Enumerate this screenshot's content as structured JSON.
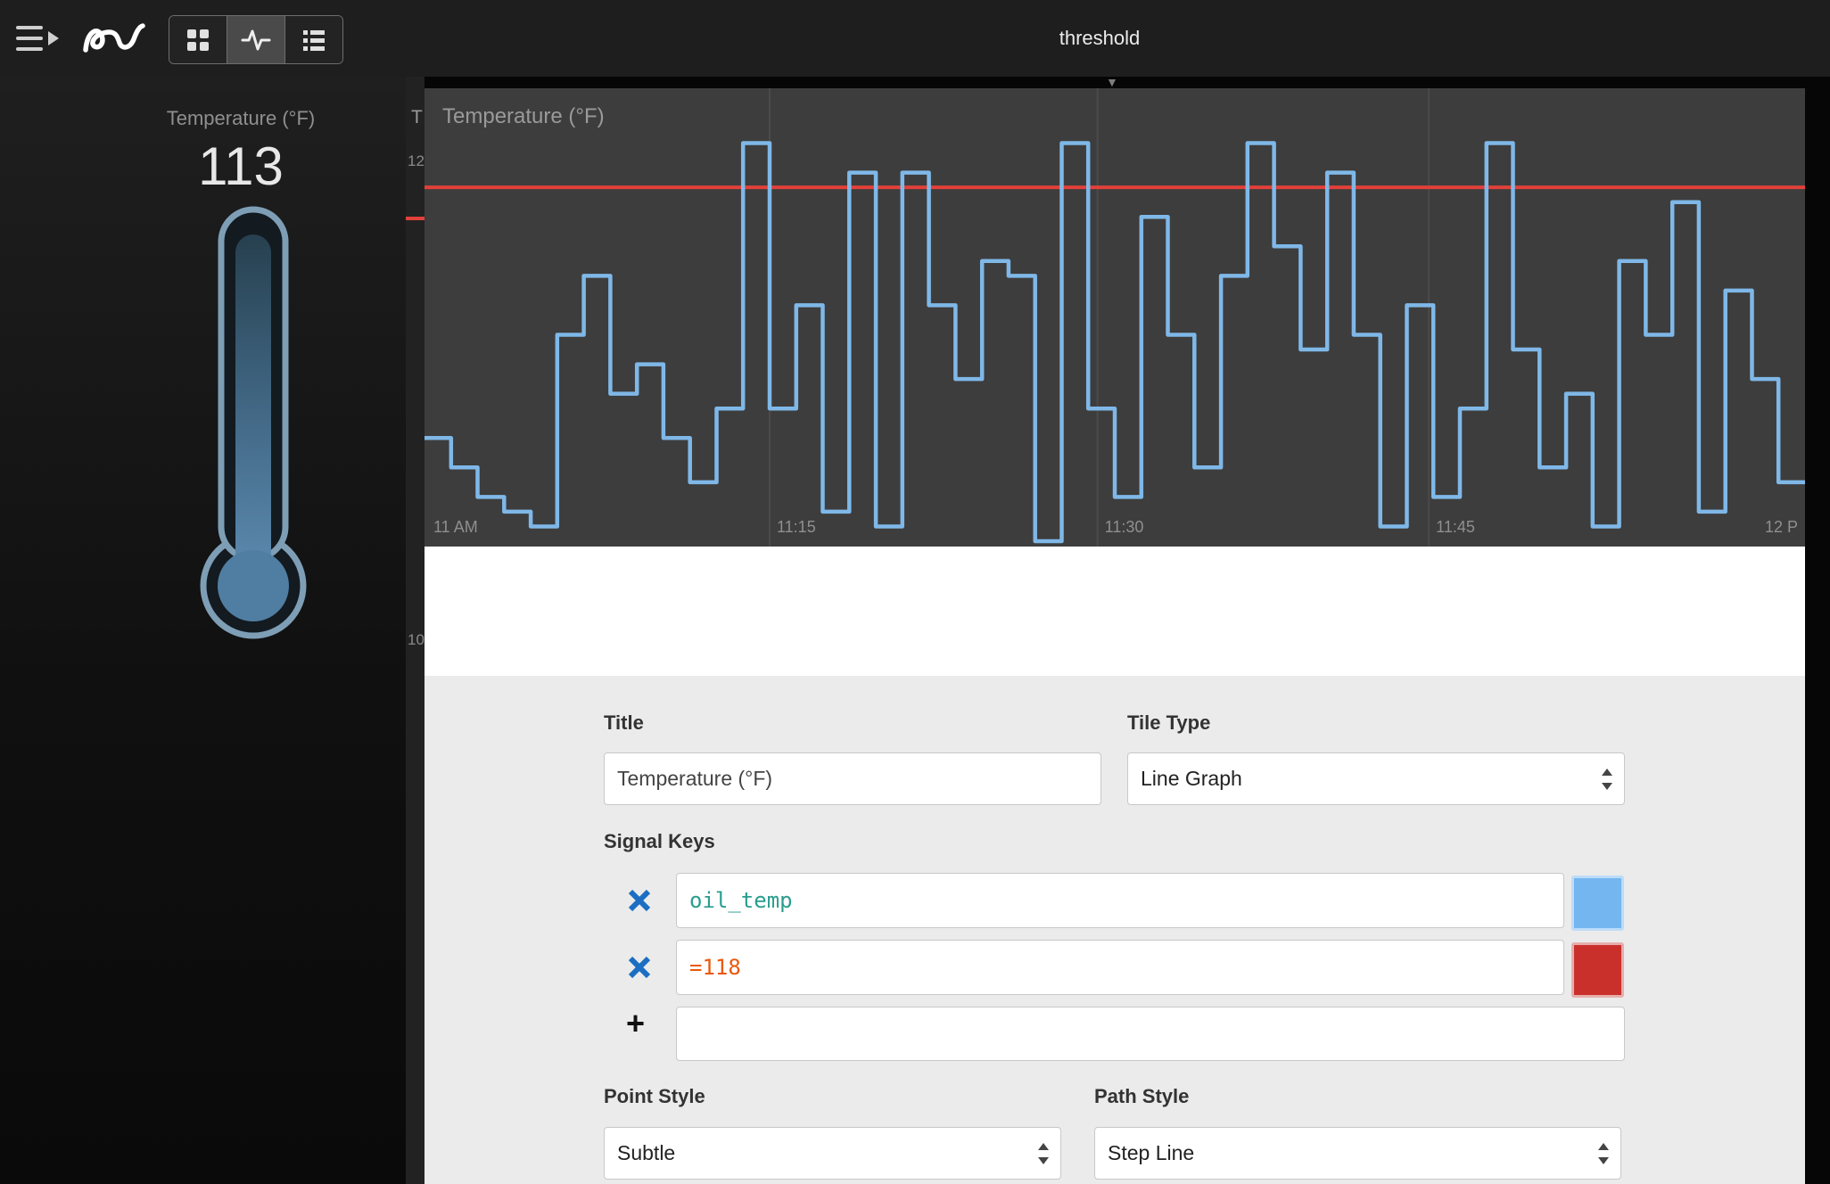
{
  "icons": {
    "caret_down": "▼",
    "add_key": "+"
  },
  "header": {
    "title": "threshold",
    "view_modes": [
      "grid",
      "waveform",
      "list"
    ],
    "active_view": "waveform"
  },
  "left_tile": {
    "title": "Temperature (°F)",
    "value": "113"
  },
  "background_tile": {
    "title_fragment": "T",
    "upper_tick": "12",
    "lower_tick": "10"
  },
  "modal": {
    "chart_title": "Temperature (°F)",
    "form": {
      "title_label": "Title",
      "title_value": "Temperature (°F)",
      "tile_type_label": "Tile Type",
      "tile_type_value": "Line Graph",
      "signal_keys_label": "Signal Keys",
      "signal_keys": [
        {
          "value": "oil_temp",
          "text_color": "#2a9d8f",
          "swatch_color": "#74b6f0",
          "swatch_border": "#bcdcf8"
        },
        {
          "value": "=118",
          "text_color": "#e8590c",
          "swatch_color": "#c9302c",
          "swatch_border": "#e6aeab"
        }
      ],
      "new_key_value": "",
      "point_style_label": "Point Style",
      "point_style_value": "Subtle",
      "path_style_label": "Path Style",
      "path_style_value": "Step Line"
    }
  },
  "chart_data": {
    "type": "line",
    "line_style": "step",
    "title": "Temperature (°F)",
    "xlabel": "",
    "ylabel": "",
    "ylim": [
      94,
      122
    ],
    "grid": "vertical-only",
    "x_axis": {
      "start_label": "11 AM",
      "tick_labels": [
        "11:15",
        "11:30",
        "11:45"
      ],
      "tick_positions": [
        0.25,
        0.4875,
        0.7275
      ],
      "end_label": "12 P"
    },
    "threshold": {
      "expression": "=118",
      "value": 118,
      "color": "#e2403a"
    },
    "series": [
      {
        "name": "oil_temp",
        "color": "#7fb8e8",
        "values": [
          101,
          99,
          97,
          96,
          95,
          108,
          112,
          104,
          106,
          101,
          98,
          103,
          121,
          103,
          110,
          96,
          119,
          95,
          119,
          110,
          105,
          113,
          112,
          94,
          121,
          103,
          97,
          116,
          108,
          99,
          112,
          121,
          114,
          107,
          119,
          108,
          95,
          110,
          97,
          103,
          121,
          107,
          99,
          104,
          95,
          113,
          108,
          117,
          96,
          111,
          105,
          98
        ]
      }
    ]
  }
}
